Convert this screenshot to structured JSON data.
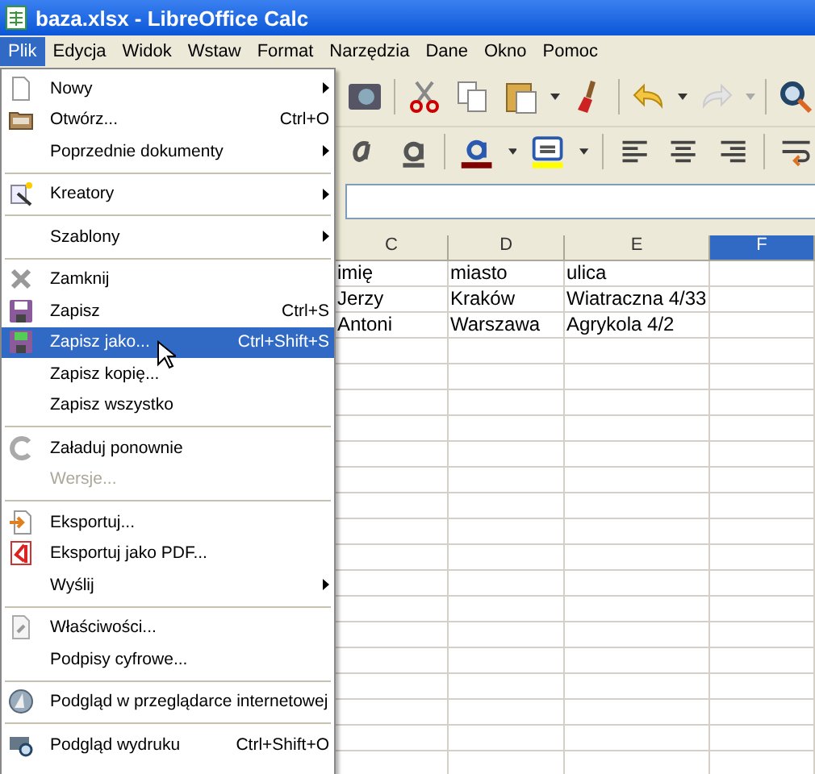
{
  "window": {
    "title": "baza.xlsx - LibreOffice Calc"
  },
  "menubar": [
    {
      "label": "Plik",
      "selected": true
    },
    {
      "label": "Edycja",
      "selected": false
    },
    {
      "label": "Widok",
      "selected": false
    },
    {
      "label": "Wstaw",
      "selected": false
    },
    {
      "label": "Format",
      "selected": false
    },
    {
      "label": "Narzędzia",
      "selected": false
    },
    {
      "label": "Dane",
      "selected": false
    },
    {
      "label": "Okno",
      "selected": false
    },
    {
      "label": "Pomoc",
      "selected": false
    }
  ],
  "file_menu": [
    [
      {
        "label": "Nowy",
        "submenu": true,
        "selected": false,
        "disabled": false
      },
      {
        "label": "Otwórz...",
        "shortcut": "Ctrl+O",
        "submenu": false,
        "selected": false,
        "disabled": false
      },
      {
        "label": "Poprzednie dokumenty",
        "submenu": true,
        "selected": false,
        "disabled": false
      }
    ],
    [
      {
        "label": "Kreatory",
        "submenu": true,
        "selected": false,
        "disabled": false
      }
    ],
    [
      {
        "label": "Szablony",
        "submenu": true,
        "selected": false,
        "disabled": false
      }
    ],
    [
      {
        "label": "Zamknij",
        "submenu": false,
        "selected": false,
        "disabled": false
      },
      {
        "label": "Zapisz",
        "shortcut": "Ctrl+S",
        "submenu": false,
        "selected": false,
        "disabled": false
      },
      {
        "label": "Zapisz jako...",
        "shortcut": "Ctrl+Shift+S",
        "submenu": false,
        "selected": true,
        "disabled": false
      },
      {
        "label": "Zapisz kopię...",
        "submenu": false,
        "selected": false,
        "disabled": false
      },
      {
        "label": "Zapisz wszystko",
        "submenu": false,
        "selected": false,
        "disabled": false
      }
    ],
    [
      {
        "label": "Załaduj ponownie",
        "submenu": false,
        "selected": false,
        "disabled": false
      },
      {
        "label": "Wersje...",
        "submenu": false,
        "selected": false,
        "disabled": true
      }
    ],
    [
      {
        "label": "Eksportuj...",
        "submenu": false,
        "selected": false,
        "disabled": false
      },
      {
        "label": "Eksportuj jako PDF...",
        "submenu": false,
        "selected": false,
        "disabled": false
      },
      {
        "label": "Wyślij",
        "submenu": true,
        "selected": false,
        "disabled": false
      }
    ],
    [
      {
        "label": "Właściwości...",
        "submenu": false,
        "selected": false,
        "disabled": false
      },
      {
        "label": "Podpisy cyfrowe...",
        "submenu": false,
        "selected": false,
        "disabled": false
      }
    ],
    [
      {
        "label": "Podgląd w przeglądarce internetowej",
        "submenu": false,
        "selected": false,
        "disabled": false
      }
    ],
    [
      {
        "label": "Podgląd wydruku",
        "shortcut": "Ctrl+Shift+O",
        "submenu": false,
        "selected": false,
        "disabled": false
      }
    ]
  ],
  "sheet": {
    "columns": [
      {
        "label": "C",
        "selected": false
      },
      {
        "label": "D",
        "selected": false
      },
      {
        "label": "E",
        "selected": false
      },
      {
        "label": "F",
        "selected": true
      }
    ],
    "rows": [
      [
        "imię",
        "miasto",
        "ulica"
      ],
      [
        "Jerzy",
        "Kraków",
        "Wiatraczna 4/33"
      ],
      [
        "Antoni",
        "Warszawa",
        "Agrykola 4/2"
      ]
    ]
  }
}
